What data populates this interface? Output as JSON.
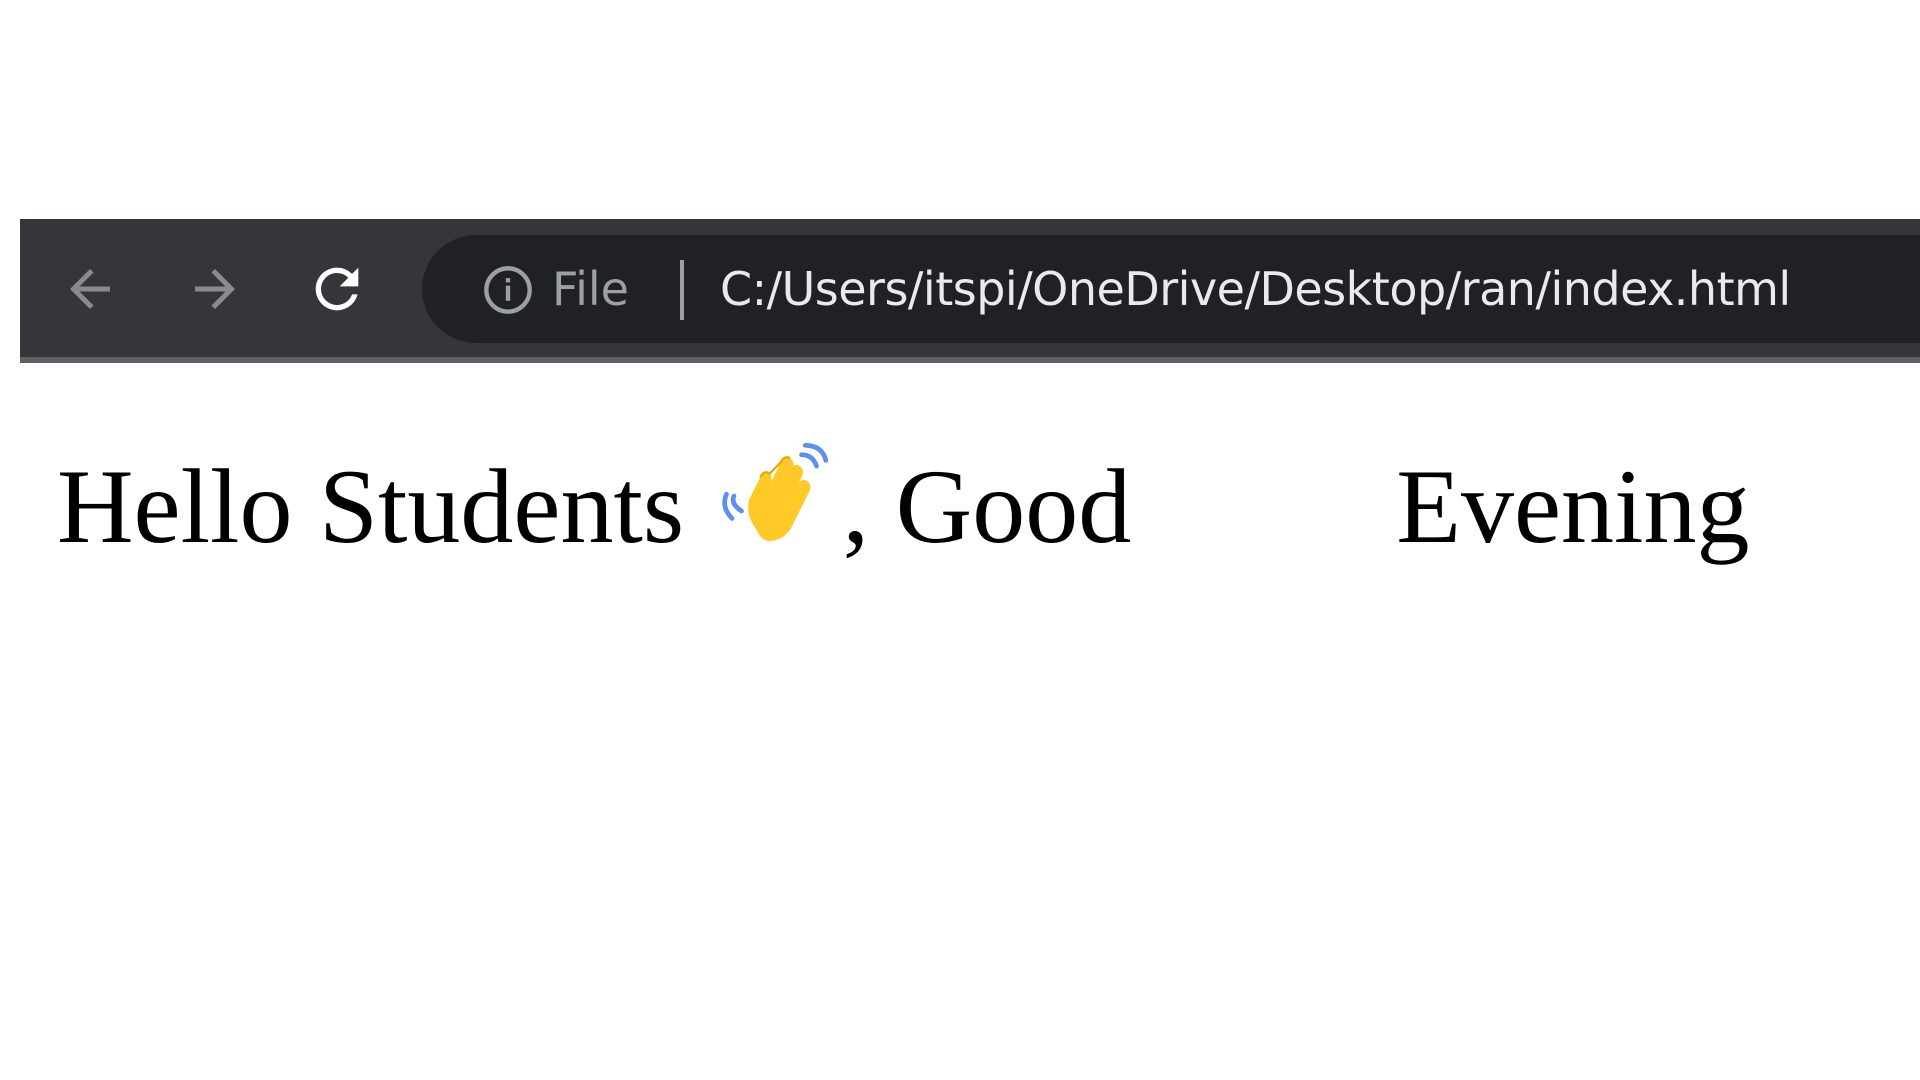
{
  "browser": {
    "nav": {
      "back_icon": "arrow-left-icon",
      "forward_icon": "arrow-right-icon",
      "reload_icon": "reload-icon"
    },
    "address_bar": {
      "info_icon": "info-icon",
      "scheme_label": "File",
      "url": "C:/Users/itspi/OneDrive/Desktop/ran/index.html"
    },
    "colors": {
      "toolbar_bg": "#35363a",
      "omnibox_bg": "#202124",
      "url_text": "#e8eaed",
      "muted_text": "#9aa0a6"
    }
  },
  "page": {
    "greeting_start": "Hello Students ",
    "emoji_icon": "waving-hand-icon",
    "greeting_end": ", Good          Evening"
  }
}
